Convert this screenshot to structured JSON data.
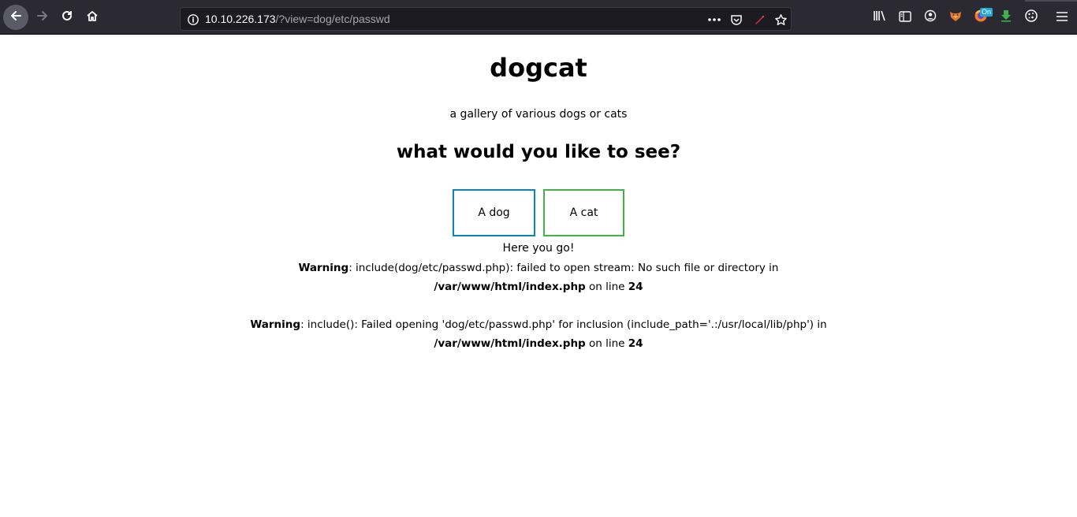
{
  "browser": {
    "url_host": "10.10.226.173",
    "url_path": "/?view=dog/etc/passwd",
    "extension_badge": "On"
  },
  "page": {
    "title": "dogcat",
    "tagline": "a gallery of various dogs or cats",
    "question": "what would you like to see?",
    "buttons": {
      "dog": "A dog",
      "cat": "A cat"
    },
    "here_text": "Here you go!",
    "warnings": [
      {
        "label": "Warning",
        "message": ": include(dog/etc/passwd.php): failed to open stream: No such file or directory in ",
        "file": "/var/www/html/index.php",
        "on_line_text": " on line ",
        "line": "24"
      },
      {
        "label": "Warning",
        "message": ": include(): Failed opening 'dog/etc/passwd.php' for inclusion (include_path='.:/usr/local/lib/php') in ",
        "file": "/var/www/html/index.php",
        "on_line_text": " on line ",
        "line": "24"
      }
    ]
  },
  "colors": {
    "toolbar_bg": "#2b2a33",
    "dog_border": "#0a85b8",
    "cat_border": "#45b04a"
  }
}
